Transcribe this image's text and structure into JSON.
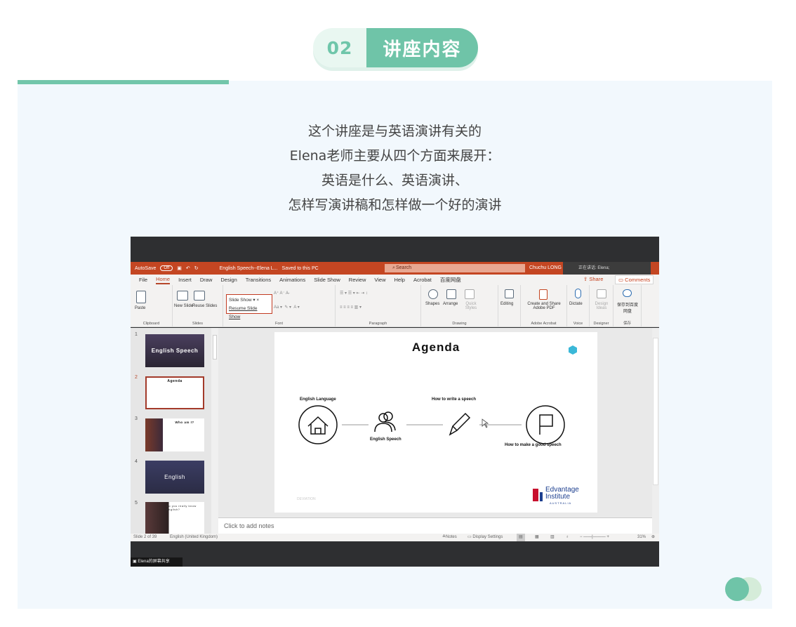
{
  "header": {
    "number": "02",
    "title": "讲座内容"
  },
  "intro_lines": [
    "这个讲座是与英语演讲有关的",
    "Elena老师主要从四个方面来展开：",
    "英语是什么、英语演讲、",
    "怎样写演讲稿和怎样做一个好的演讲"
  ],
  "ppt": {
    "autosave_label": "AutoSave",
    "autosave_state": "Off",
    "doc_title": "English Speech--Elena L...",
    "save_status": "Saved to this PC",
    "search_placeholder": "Search",
    "user": "Chuchu LONG",
    "speaking": "正在讲话: Elena;",
    "menu": [
      "File",
      "Home",
      "Insert",
      "Draw",
      "Design",
      "Transitions",
      "Animations",
      "Slide Show",
      "Review",
      "View",
      "Help",
      "Acrobat",
      "百度网盘"
    ],
    "share": "Share",
    "comments": "Comments",
    "ribbon": {
      "paste": "Paste",
      "new_slide": "New Slide",
      "reuse_slides": "Reuse Slides",
      "slideshow_dropdown": "Slide Show",
      "resume_slideshow": "Resume Slide Show",
      "shapes": "Shapes",
      "arrange": "Arrange",
      "quick_styles": "Quick Styles",
      "editing": "Editing",
      "create_share_pdf": "Create and Share Adobe PDF",
      "dictate": "Dictate",
      "design_ideas": "Design Ideas",
      "save_baidu": "保存到百度网盘",
      "groups": [
        "Clipboard",
        "Slides",
        "Font",
        "Paragraph",
        "Drawing",
        "Adobe Acrobat",
        "Voice",
        "Designer",
        "保存"
      ]
    },
    "thumbnails": [
      {
        "n": "1",
        "title": "English Speech"
      },
      {
        "n": "2",
        "title": "Agenda"
      },
      {
        "n": "3",
        "title": "Who am I?"
      },
      {
        "n": "4",
        "title": "English"
      },
      {
        "n": "5",
        "title": "Do you really know English?"
      }
    ],
    "slide": {
      "title": "Agenda",
      "items": [
        "English Language",
        "English Speech",
        "How to write a speech",
        "How to make a good speech"
      ],
      "logo_line1": "Edvantage",
      "logo_line2": "Institute",
      "logo_line3": "AUSTRALIA",
      "footer_mark": "DEVIATION"
    },
    "notes_placeholder": "Click to add notes",
    "status": {
      "slide_of": "Slide 2 of 39",
      "language": "English (United Kingdom)",
      "notes": "Notes",
      "display_settings": "Display Settings",
      "zoom": "31%"
    },
    "share_label": "Elena的屏幕共享"
  },
  "colors": {
    "accent": "#6fc4a8",
    "pill_light": "#e9f7f1",
    "card_bg": "#f2f8fd",
    "ppt_red": "#c44622"
  }
}
